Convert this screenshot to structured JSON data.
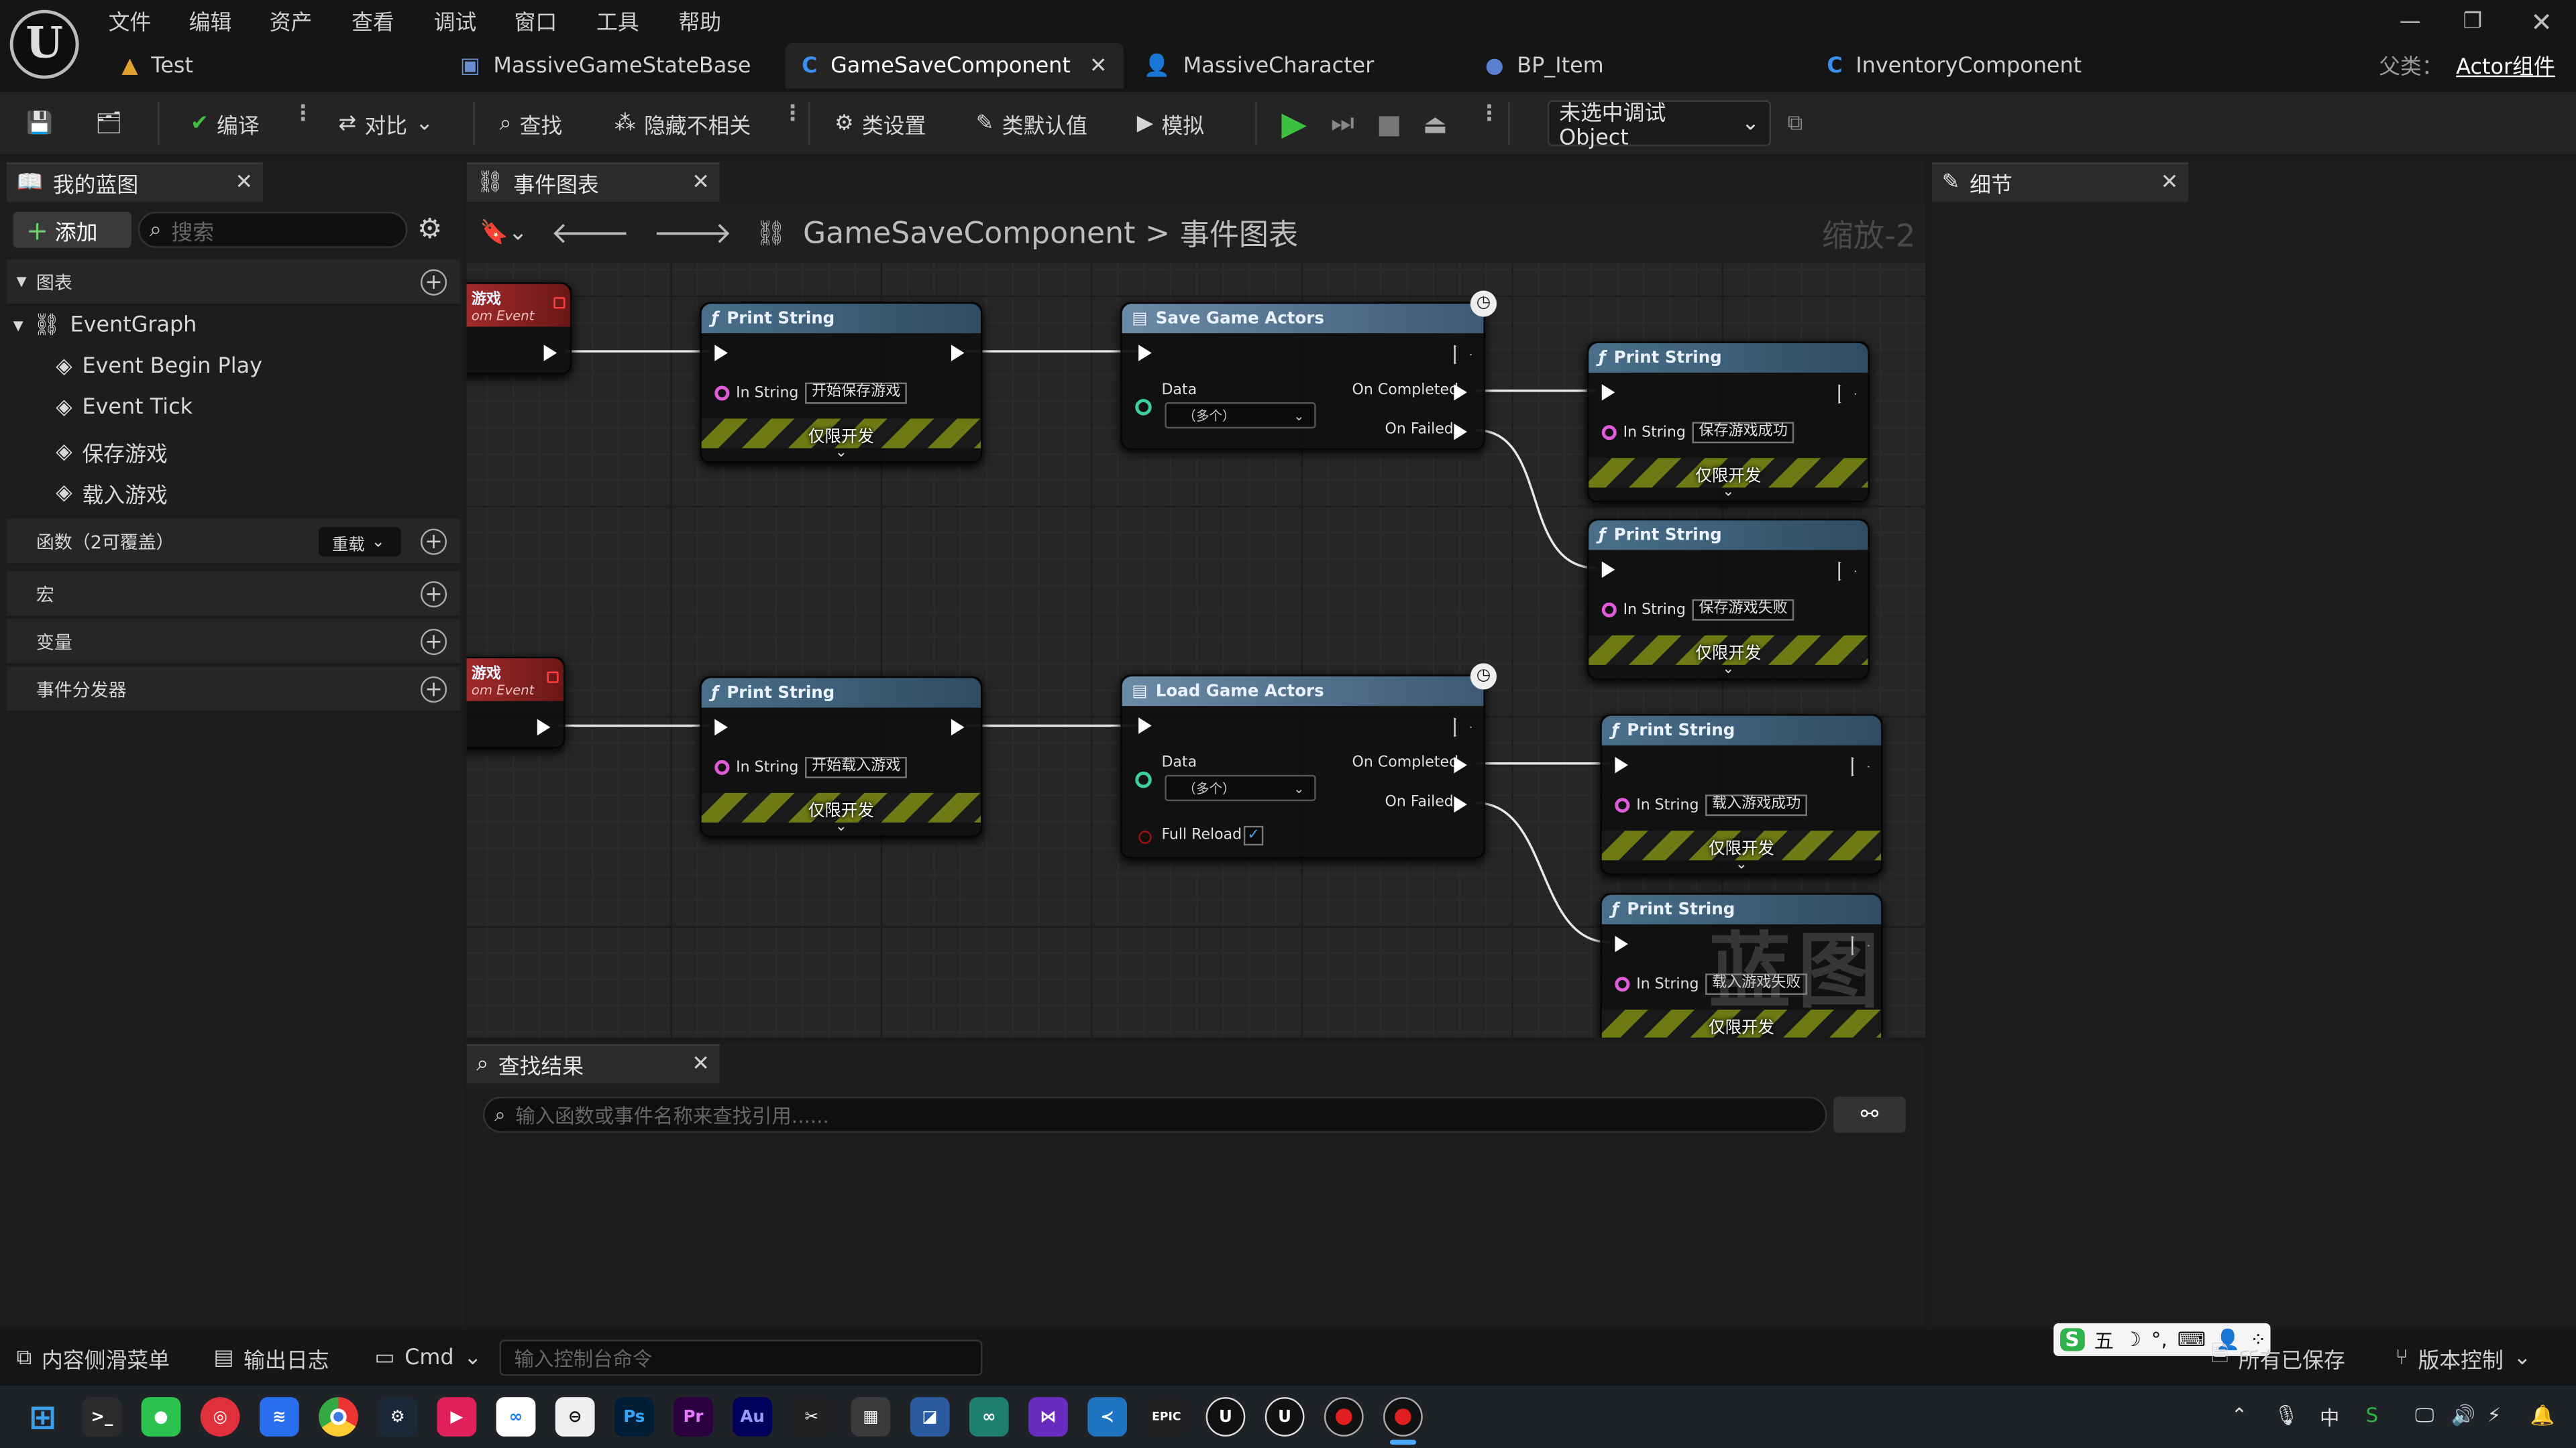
{
  "menu": [
    "文件",
    "编辑",
    "资产",
    "查看",
    "调试",
    "窗口",
    "工具",
    "帮助"
  ],
  "project_tab": "Test",
  "doc_tabs": [
    "MassiveGameStateBase",
    "GameSaveComponent",
    "MassiveCharacter",
    "BP_Item",
    "InventoryComponent"
  ],
  "parent_class": {
    "label": "父类：",
    "value": "Actor组件"
  },
  "toolbar": {
    "compile": "编译",
    "diff": "对比",
    "find": "查找",
    "hide_unrelated": "隐藏不相关",
    "class_settings": "类设置",
    "class_defaults": "类默认值",
    "simulate": "模拟",
    "debug_object": "未选中调试Object"
  },
  "my_blueprint": {
    "tab": "我的蓝图",
    "add": "添加",
    "search_placeholder": "搜索",
    "graphs_label": "图表",
    "event_graph": "EventGraph",
    "events": [
      "Event Begin Play",
      "Event Tick",
      "保存游戏",
      "载入游戏"
    ],
    "functions": "函数（2可覆盖）",
    "override": "重载",
    "macros": "宏",
    "variables": "变量",
    "dispatchers": "事件分发器"
  },
  "graph": {
    "tab": "事件图表",
    "breadcrumb_root": "GameSaveComponent",
    "breadcrumb_sep": ">",
    "breadcrumb_leaf": "事件图表",
    "zoom": "缩放-2",
    "watermark": "蓝图",
    "event_title_a": "游戏",
    "event_title_b": "游戏",
    "event_subtitle": "om Event",
    "nodes": {
      "print_save_start": {
        "title": "Print String",
        "pin": "In String",
        "value": "开始保存游戏",
        "dev": "仅限开发"
      },
      "save_actors": {
        "title": "Save Game Actors",
        "data": "Data",
        "data_value": "（多个）",
        "completed": "On Completed",
        "failed": "On Failed"
      },
      "print_save_ok": {
        "title": "Print String",
        "pin": "In String",
        "value": "保存游戏成功",
        "dev": "仅限开发"
      },
      "print_save_fail": {
        "title": "Print String",
        "pin": "In String",
        "value": "保存游戏失败",
        "dev": "仅限开发"
      },
      "print_load_start": {
        "title": "Print String",
        "pin": "In String",
        "value": "开始载入游戏",
        "dev": "仅限开发"
      },
      "load_actors": {
        "title": "Load Game Actors",
        "data": "Data",
        "data_value": "（多个）",
        "completed": "On Completed",
        "failed": "On Failed",
        "full_reload": "Full Reload"
      },
      "print_load_ok": {
        "title": "Print String",
        "pin": "In String",
        "value": "载入游戏成功",
        "dev": "仅限开发"
      },
      "print_load_fail": {
        "title": "Print String",
        "pin": "In String",
        "value": "载入游戏失败",
        "dev": "仅限开发"
      }
    }
  },
  "find_results": {
    "tab": "查找结果",
    "placeholder": "输入函数或事件名称来查找引用......"
  },
  "details": {
    "tab": "细节"
  },
  "bottom": {
    "content_drawer": "内容侧滑菜单",
    "output_log": "输出日志",
    "cmd": "Cmd",
    "console_placeholder": "输入控制台命令",
    "all_saved": "所有已保存",
    "source_control": "版本控制",
    "ime": "五"
  },
  "taskbar": {
    "apps": [
      "terminal",
      "wechat",
      "netease-music",
      "feishu",
      "chrome",
      "steam",
      "kuaishou",
      "meta",
      "obs",
      "Ps",
      "Pr",
      "Au",
      "capcut",
      "calculator",
      "network",
      "infinity",
      "visual-studio",
      "vscode",
      "epic-games",
      "unreal-1",
      "unreal-2",
      "record-1",
      "record-2"
    ],
    "lang": "中"
  },
  "colors": {
    "accent_blue": "#2a7fd4",
    "play_green": "#3fbf3f",
    "string_pin": "#e05cd9",
    "hazard": "#6e7a14"
  }
}
